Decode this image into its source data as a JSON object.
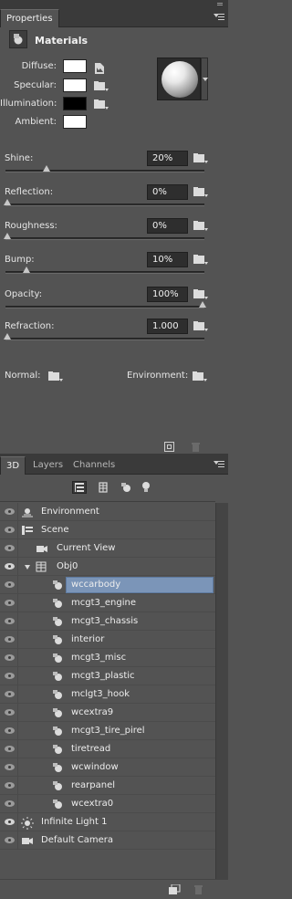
{
  "properties_panel": {
    "tab_title": "Properties",
    "header_title": "Materials",
    "materials": [
      {
        "label": "Diffuse:",
        "swatch_color": "#ffffff"
      },
      {
        "label": "Specular:",
        "swatch_color": "#ffffff"
      },
      {
        "label": "Illumination:",
        "swatch_color": "#000000"
      },
      {
        "label": "Ambient:",
        "swatch_color": "#ffffff"
      }
    ],
    "sliders": [
      {
        "label": "Shine:",
        "value": "20%",
        "level": 0.2
      },
      {
        "label": "Reflection:",
        "value": "0%",
        "level": 0.0
      },
      {
        "label": "Roughness:",
        "value": "0%",
        "level": 0.0
      },
      {
        "label": "Bump:",
        "value": "10%",
        "level": 0.1
      },
      {
        "label": "Opacity:",
        "value": "100%",
        "level": 1.0
      },
      {
        "label": "Refraction:",
        "value": "1.000",
        "level": 0.0
      }
    ],
    "normal_label": "Normal:",
    "environment_label": "Environment:"
  },
  "panel_3d": {
    "tabs": [
      "3D",
      "Layers",
      "Channels"
    ],
    "items": [
      {
        "label": "Environment",
        "icon": "environment-icon",
        "indent": 0,
        "eye": "dim",
        "selected": false
      },
      {
        "label": "Scene",
        "icon": "scene-icon",
        "indent": 0,
        "eye": "dim",
        "selected": false
      },
      {
        "label": "Current View",
        "icon": "camera-icon",
        "indent": 1,
        "eye": "dim",
        "selected": false
      },
      {
        "label": "Obj0",
        "icon": "mesh-icon",
        "indent": 1,
        "eye": "bright",
        "selected": false,
        "expanded": true
      },
      {
        "label": "wccarbody",
        "icon": "material-icon",
        "indent": 2,
        "eye": "dim",
        "selected": true
      },
      {
        "label": "mcgt3_engine",
        "icon": "material-icon",
        "indent": 2,
        "eye": "dim",
        "selected": false
      },
      {
        "label": "mcgt3_chassis",
        "icon": "material-icon",
        "indent": 2,
        "eye": "dim",
        "selected": false
      },
      {
        "label": "interior",
        "icon": "material-icon",
        "indent": 2,
        "eye": "dim",
        "selected": false
      },
      {
        "label": "mcgt3_misc",
        "icon": "material-icon",
        "indent": 2,
        "eye": "dim",
        "selected": false
      },
      {
        "label": "mcgt3_plastic",
        "icon": "material-icon",
        "indent": 2,
        "eye": "dim",
        "selected": false
      },
      {
        "label": "mclgt3_hook",
        "icon": "material-icon",
        "indent": 2,
        "eye": "dim",
        "selected": false
      },
      {
        "label": "wcextra9",
        "icon": "material-icon",
        "indent": 2,
        "eye": "dim",
        "selected": false
      },
      {
        "label": "mcgt3_tire_pirel",
        "icon": "material-icon",
        "indent": 2,
        "eye": "dim",
        "selected": false
      },
      {
        "label": "tiretread",
        "icon": "material-icon",
        "indent": 2,
        "eye": "dim",
        "selected": false
      },
      {
        "label": "wcwindow",
        "icon": "material-icon",
        "indent": 2,
        "eye": "dim",
        "selected": false
      },
      {
        "label": "rearpanel",
        "icon": "material-icon",
        "indent": 2,
        "eye": "dim",
        "selected": false
      },
      {
        "label": "wcextra0",
        "icon": "material-icon",
        "indent": 2,
        "eye": "dim",
        "selected": false
      },
      {
        "label": "Infinite Light 1",
        "icon": "light-icon",
        "indent": 0,
        "eye": "bright",
        "selected": false
      },
      {
        "label": "Default Camera",
        "icon": "camera-icon",
        "indent": 0,
        "eye": "dim",
        "selected": false
      }
    ]
  }
}
